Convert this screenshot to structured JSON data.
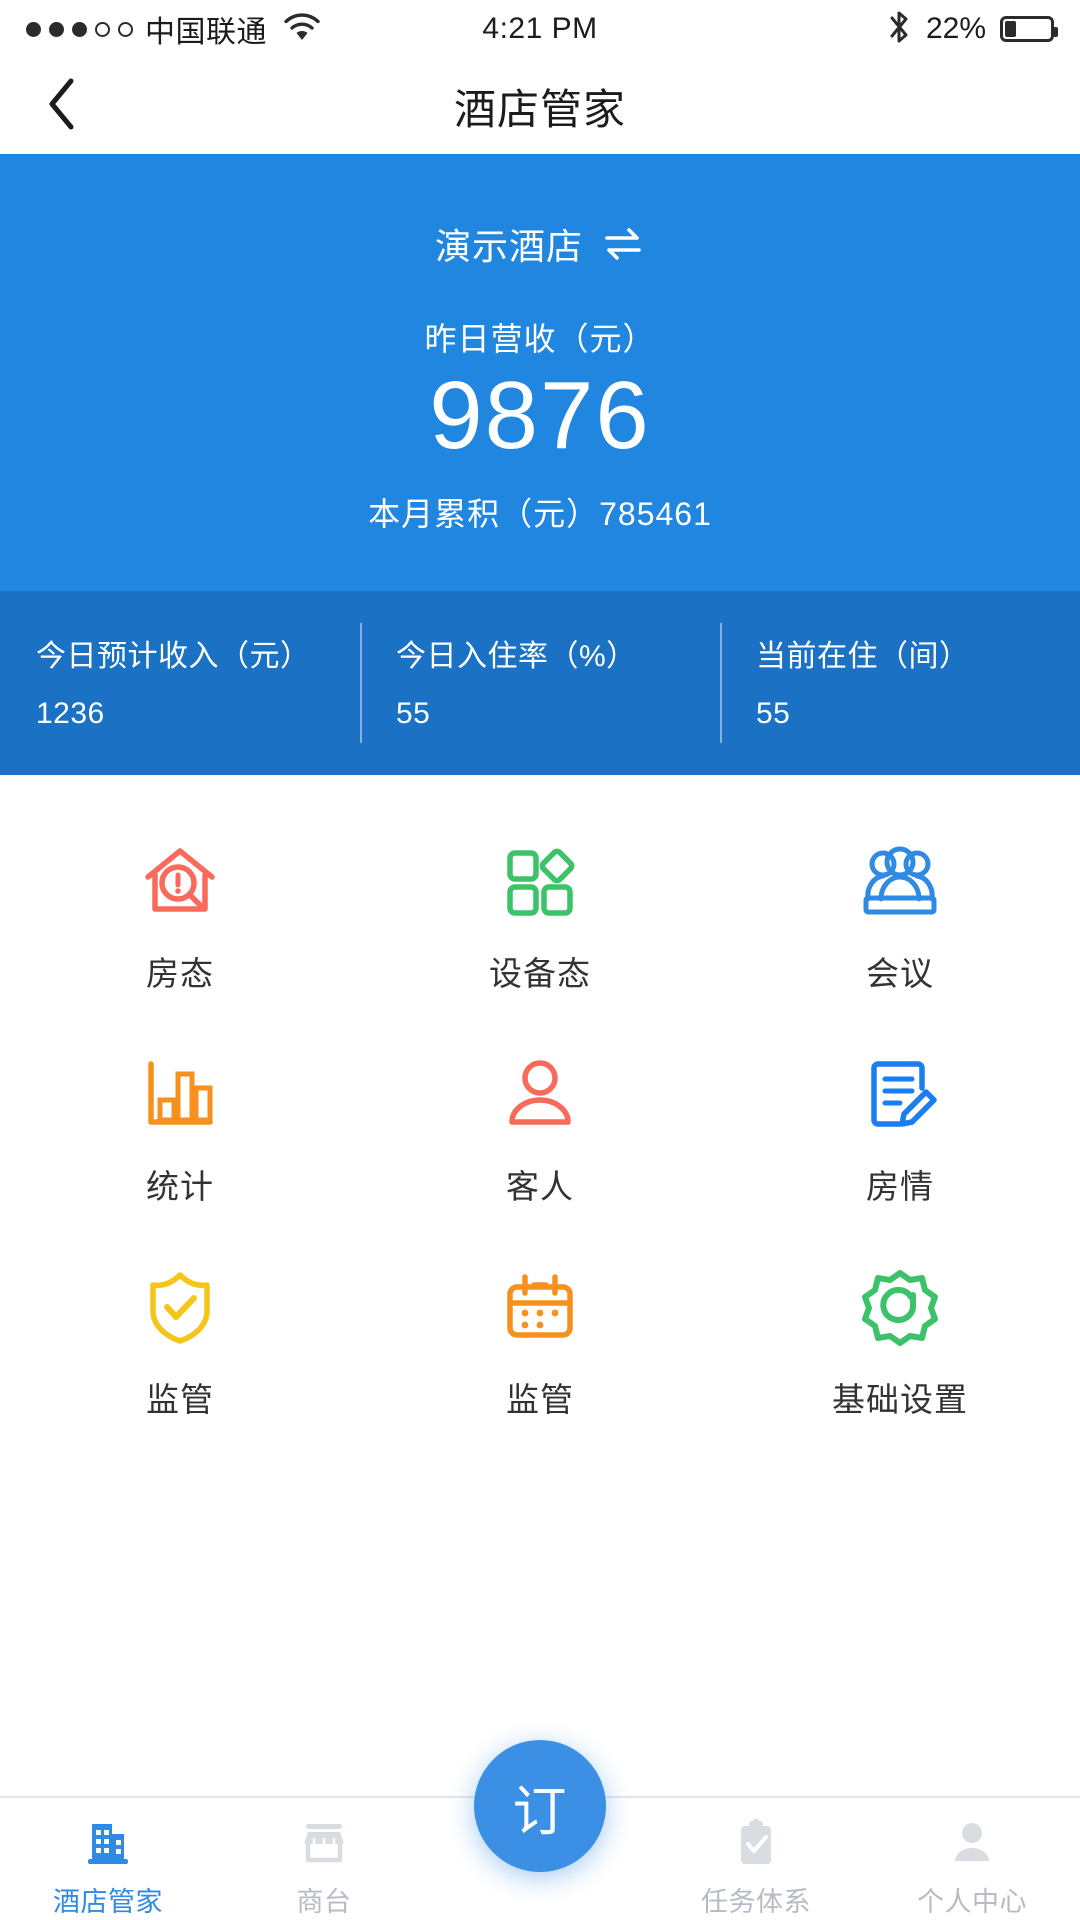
{
  "status_bar": {
    "signal_dots_total": 5,
    "signal_dots_filled": 3,
    "carrier": "中国联通",
    "wifi_icon": "wifi-icon",
    "time": "4:21 PM",
    "bluetooth_icon": "bluetooth-icon",
    "battery_percent": "22%",
    "battery_level": 22
  },
  "navbar": {
    "back_icon": "chevron-left-icon",
    "title": "酒店管家"
  },
  "hero": {
    "hotel_name": "演示酒店",
    "switch_icon": "swap-arrows-icon",
    "revenue_label": "昨日营收（元）",
    "revenue_value": "9876",
    "month_total": "本月累积（元）785461",
    "background_color": "#2186e0"
  },
  "stats": {
    "background_color": "#1b72c4",
    "items": [
      {
        "label": "今日预计收入（元）",
        "value": "1236"
      },
      {
        "label": "今日入住率（%）",
        "value": "55"
      },
      {
        "label": "当前在住（间）",
        "value": "55"
      }
    ]
  },
  "grid": {
    "items": [
      {
        "label": "房态",
        "icon": "house-search-alert-icon",
        "color": "#f96a5a"
      },
      {
        "label": "设备态",
        "icon": "grid-diamond-icon",
        "color": "#3cc268"
      },
      {
        "label": "会议",
        "icon": "people-group-icon",
        "color": "#2f8ae4"
      },
      {
        "label": "统计",
        "icon": "bar-chart-icon",
        "color": "#f6901e"
      },
      {
        "label": "客人",
        "icon": "person-icon",
        "color": "#f96a5a"
      },
      {
        "label": "房情",
        "icon": "document-edit-icon",
        "color": "#1a7df0"
      },
      {
        "label": "监管",
        "icon": "shield-check-icon",
        "color": "#f5c518"
      },
      {
        "label": "监管",
        "icon": "calendar-icon",
        "color": "#f6901e"
      },
      {
        "label": "基础设置",
        "icon": "gear-icon",
        "color": "#3cc268"
      }
    ]
  },
  "tabbar": {
    "active_color": "#2f8ae4",
    "inactive_color": "#b6bcc4",
    "fab": {
      "label": "订",
      "icon": "order-fab",
      "color": "#3b8fe4"
    },
    "items": [
      {
        "label": "酒店管家",
        "icon": "building-icon",
        "active": true
      },
      {
        "label": "商台",
        "icon": "shop-icon",
        "active": false
      },
      {
        "label": "任务体系",
        "icon": "clipboard-check-icon",
        "active": false
      },
      {
        "label": "个人中心",
        "icon": "person-icon",
        "active": false
      }
    ]
  }
}
